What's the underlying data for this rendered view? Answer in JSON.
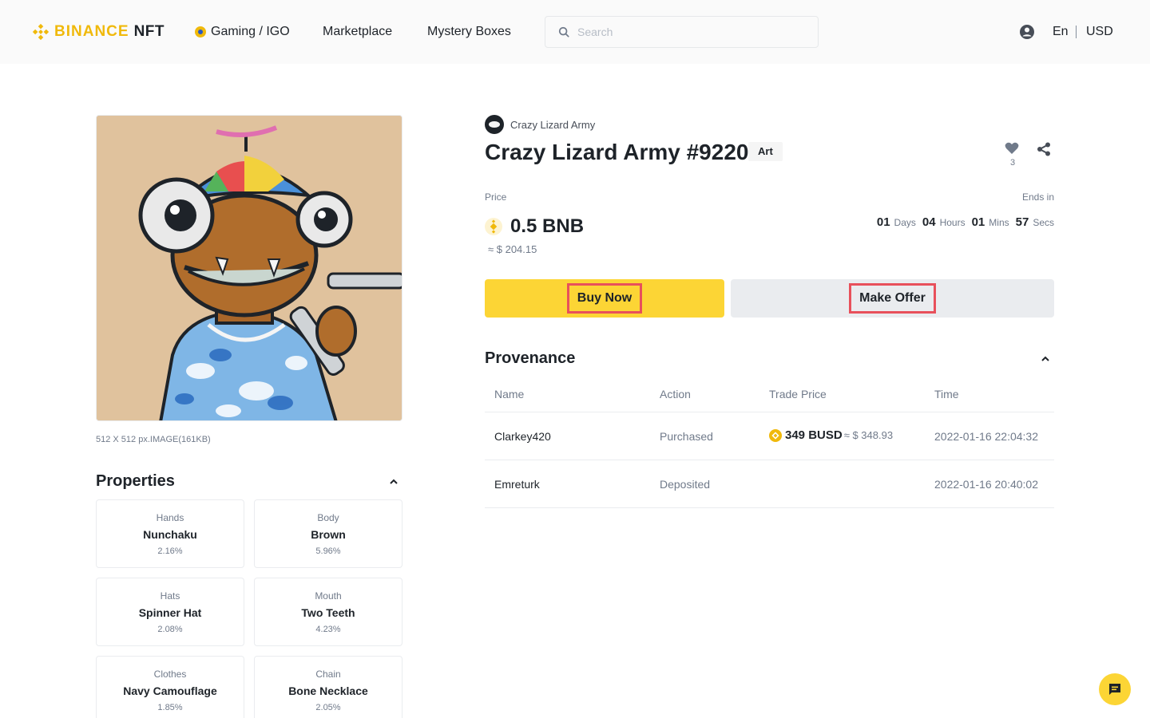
{
  "header": {
    "logo_text": "BINANCE",
    "logo_suffix": "NFT",
    "nav": {
      "gaming": "Gaming / IGO",
      "marketplace": "Marketplace",
      "mystery": "Mystery Boxes"
    },
    "search_placeholder": "Search",
    "language": "En",
    "currency": "USD"
  },
  "image": {
    "meta": "512 X 512 px.IMAGE(161KB)"
  },
  "properties": {
    "title": "Properties",
    "items": [
      {
        "type": "Hands",
        "value": "Nunchaku",
        "rarity": "2.16%"
      },
      {
        "type": "Body",
        "value": "Brown",
        "rarity": "5.96%"
      },
      {
        "type": "Hats",
        "value": "Spinner Hat",
        "rarity": "2.08%"
      },
      {
        "type": "Mouth",
        "value": "Two Teeth",
        "rarity": "4.23%"
      },
      {
        "type": "Clothes",
        "value": "Navy Camouflage",
        "rarity": "1.85%"
      },
      {
        "type": "Chain",
        "value": "Bone Necklace",
        "rarity": "2.05%"
      }
    ]
  },
  "nft": {
    "collection": "Crazy Lizard Army",
    "title": "Crazy Lizard Army #9220",
    "tag": "Art",
    "likes": "3",
    "price_label": "Price",
    "price": "0.5 BNB",
    "price_usd": "≈ $ 204.15",
    "ends_label": "Ends in",
    "countdown": {
      "days": "01",
      "days_label": "Days",
      "hours": "04",
      "hours_label": "Hours",
      "mins": "01",
      "mins_label": "Mins",
      "secs": "57",
      "secs_label": "Secs"
    },
    "buy_label": "Buy Now",
    "offer_label": "Make Offer"
  },
  "provenance": {
    "title": "Provenance",
    "columns": [
      "Name",
      "Action",
      "Trade Price",
      "Time"
    ],
    "rows": [
      {
        "name": "Clarkey420",
        "action": "Purchased",
        "price": "349 BUSD",
        "price_usd": "≈ $ 348.93",
        "time": "2022-01-16 22:04:32"
      },
      {
        "name": "Emreturk",
        "action": "Deposited",
        "price": "",
        "price_usd": "",
        "time": "2022-01-16 20:40:02"
      }
    ]
  },
  "colors": {
    "brand": "#f0b90b",
    "buy_button": "#fcd535",
    "offer_button": "#eaecef",
    "highlight_border": "#e8505b"
  }
}
